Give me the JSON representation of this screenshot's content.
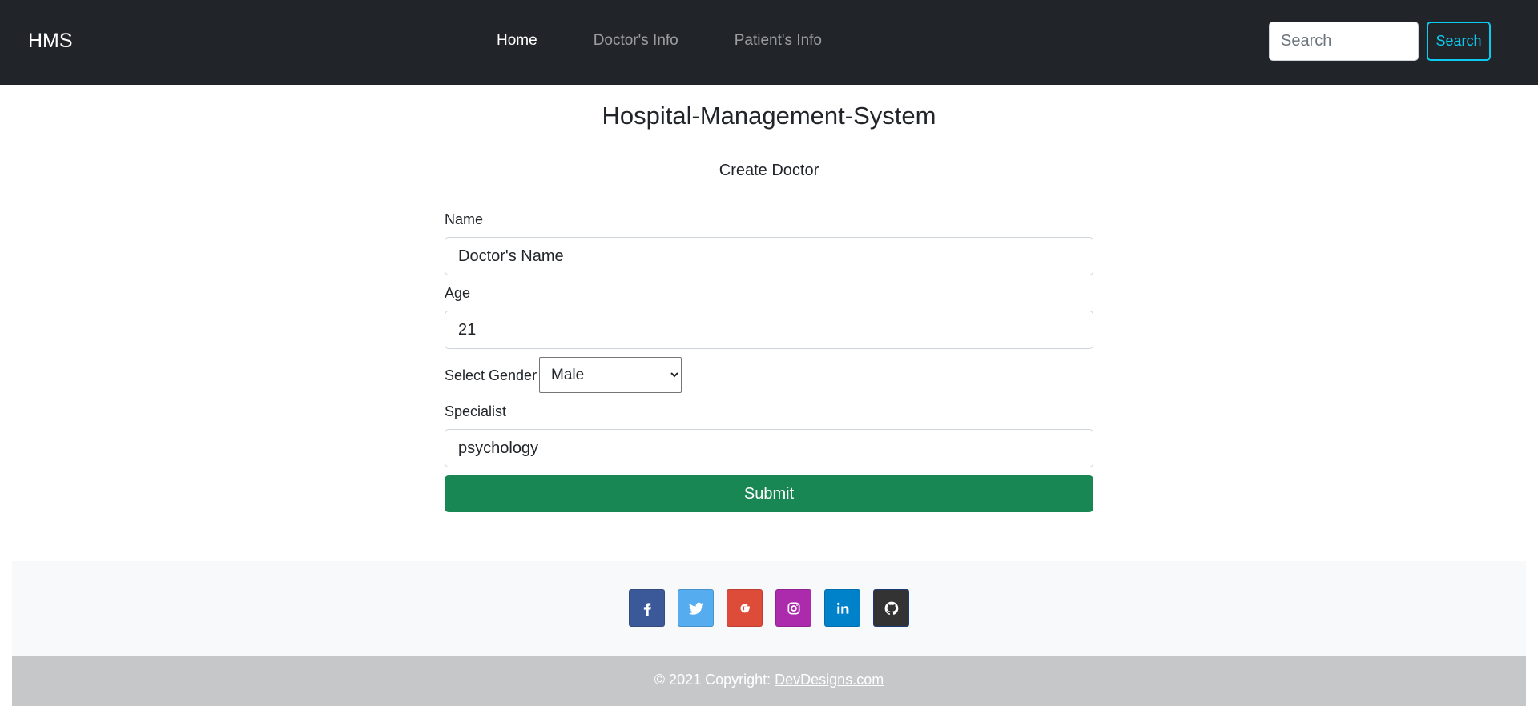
{
  "navbar": {
    "brand": "HMS",
    "links": [
      {
        "label": "Home",
        "active": true
      },
      {
        "label": "Doctor's Info",
        "active": false
      },
      {
        "label": "Patient's Info",
        "active": false
      }
    ],
    "search_placeholder": "Search",
    "search_button": "Search"
  },
  "page": {
    "title": "Hospital-Management-System",
    "form_title": "Create Doctor"
  },
  "form": {
    "name_label": "Name",
    "name_value": "Doctor's Name",
    "age_label": "Age",
    "age_value": "21",
    "gender_label": "Select Gender",
    "gender_selected": "Male",
    "specialist_label": "Specialist",
    "specialist_value": "psychology",
    "submit_label": "Submit"
  },
  "footer": {
    "social": [
      {
        "icon": "facebook-icon",
        "color": "#3b5998"
      },
      {
        "icon": "twitter-icon",
        "color": "#55acee"
      },
      {
        "icon": "google-icon",
        "color": "#dd4b39"
      },
      {
        "icon": "instagram-icon",
        "color": "#ac2bac"
      },
      {
        "icon": "linkedin-icon",
        "color": "#0082ca"
      },
      {
        "icon": "github-icon",
        "color": "#333333"
      }
    ],
    "copyright_text": "© 2021 Copyright: ",
    "copyright_link": "DevDesigns.com"
  },
  "colors": {
    "navbar_bg": "#212529",
    "search_accent": "#0dcaf0",
    "submit_bg": "#198754",
    "footer_top_bg": "#f8f9fa",
    "footer_bottom_bg": "#c6c7c9"
  }
}
